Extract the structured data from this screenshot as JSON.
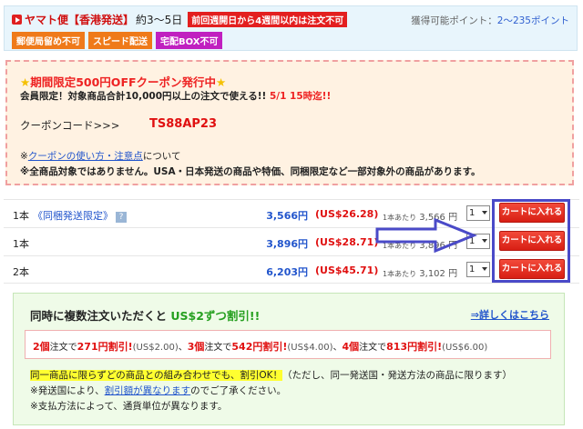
{
  "shipping": {
    "carrier": "ヤマト便【香港発送】",
    "days": "約3～5日",
    "warning": "前回週開日から4週間以内は注文不可",
    "points_label": "獲得可能ポイント：",
    "points_value": "2～235ポイント",
    "tags": [
      "郵便局留め不可",
      "スピード配送",
      "宅配BOX不可"
    ]
  },
  "coupon": {
    "star": "★",
    "title": "期間限定500円OFFクーポン発行中",
    "subtitle": "会員限定！対象商品合計10,000円以上の注文で使える!!",
    "deadline": "5/1 15時迄!!",
    "code_label": "クーポンコード>>>",
    "code": "TS88AP23",
    "note_prefix": "※",
    "note_link": "クーポンの使い方・注意点",
    "note_suffix": "について",
    "note2": "※全商品対象ではありません。USA・日本発送の商品や特価、同梱限定など一部対象外の商品があります。"
  },
  "prices": [
    {
      "qty": "1本",
      "note": "《同梱発送限定》",
      "price": "3,566円",
      "usd": "(US$26.28)",
      "per_label": "1本あたり",
      "per": "3,566 円",
      "select": "1",
      "cart": "カートに入れる"
    },
    {
      "qty": "1本",
      "note": "",
      "price": "3,896円",
      "usd": "(US$28.71)",
      "per_label": "1本あたり",
      "per": "3,896 円",
      "select": "1",
      "cart": "カートに入れる"
    },
    {
      "qty": "2本",
      "note": "",
      "price": "6,203円",
      "usd": "(US$45.71)",
      "per_label": "1本あたり",
      "per": "3,102 円",
      "select": "1",
      "cart": "カートに入れる"
    }
  ],
  "help_icon": "?",
  "discount": {
    "title_prefix": "同時に複数注文いただくと ",
    "title_highlight": "US$2ずつ割引!!",
    "more_link": "⇒詳しくはこちら",
    "rates": [
      {
        "big": "2個",
        "mid": "注文で",
        "amount": "271円割引!",
        "usd": "(US$2.00)"
      },
      {
        "big": "3個",
        "mid": "注文で",
        "amount": "542円割引!",
        "usd": "(US$4.00)"
      },
      {
        "big": "4個",
        "mid": "注文で",
        "amount": "813円割引!",
        "usd": "(US$6.00)"
      }
    ],
    "note1_highlight": "同一商品に限らずどの商品との組み合わせでも、割引OK！",
    "note1_rest": "（ただし、同一発送国・発送方法の商品に限ります）",
    "note2_prefix": "※発送国により、",
    "note2_link": "割引額が異なります",
    "note2_suffix": "のでご了承ください。",
    "note3": "※支払方法によって、通貨単位が異なります。"
  },
  "colors": {
    "accent_red": "#e01010",
    "link_blue": "#2255cc",
    "highlight_box": "#4a4ac8"
  }
}
